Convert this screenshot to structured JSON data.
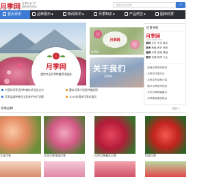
{
  "header": {
    "logo": "月季网",
    "logo_url": "www.yjadm.com",
    "slogan_line1": "月季行业门户",
    "slogan_line2": "园林花卉网站",
    "search_placeholder": "搜索花卉品种",
    "search_button": "搜索"
  },
  "nav": {
    "items": [
      {
        "label": "首页资讯",
        "icon": "home-icon",
        "active": true
      },
      {
        "label": "品种展示",
        "icon": "flower-icon"
      },
      {
        "label": "新闻资讯",
        "icon": "news-icon"
      },
      {
        "label": "月季知识",
        "icon": "book-icon"
      },
      {
        "label": "产品供应",
        "icon": "cart-icon"
      },
      {
        "label": "图库欣赏",
        "icon": "image-icon"
      }
    ]
  },
  "hero": {
    "badge_logo": "月季网",
    "badge_sub": "提供专业月季种植资讯服务"
  },
  "tiles": {
    "t1_logo": "月季网",
    "t1_caption": "月季网",
    "t2_title": "关于我们",
    "t2_sub": "月季网"
  },
  "news": [
    {
      "text": "中国的月季品种种植技术及优点分",
      "color": "#3c7bd4"
    },
    {
      "text": "藤本月季介绍及种植说明",
      "color": "#e6a02d"
    },
    {
      "text": "月季盆栽种植方法及养护技巧详解",
      "color": "#3c7bd4"
    },
    {
      "text": "2020年国庆月季花展示",
      "color": "#e6a02d"
    }
  ],
  "sidebar": {
    "title": "栏目导航",
    "logo": "月季网",
    "logo_sub": "www.yjadm.com",
    "lines": [
      {
        "key": "品种",
        "val": "大花 丰花 藤本"
      },
      {
        "key": "技术",
        "val": "种植 养护 病虫"
      },
      {
        "key": "品牌",
        "val": "月季 玫瑰 蔷薇"
      },
      {
        "key": "资讯",
        "val": "花展 新闻 行业"
      }
    ],
    "items": [
      "· 盆栽月季怎样养护",
      "· 月季花扦插方法",
      "· 月季花的品种介绍",
      "· 藤本月季如何修剪",
      "· 丰花月季种植要点",
      "· 月季黑斑病的防治"
    ]
  },
  "section": {
    "title": "月季品种",
    "more": "更多 >"
  },
  "cards": [
    {
      "caption": "大花月季"
    },
    {
      "caption": "丰花月季花园月季"
    },
    {
      "caption": "红色月季藤本月季"
    },
    {
      "caption": "切花月季"
    }
  ]
}
